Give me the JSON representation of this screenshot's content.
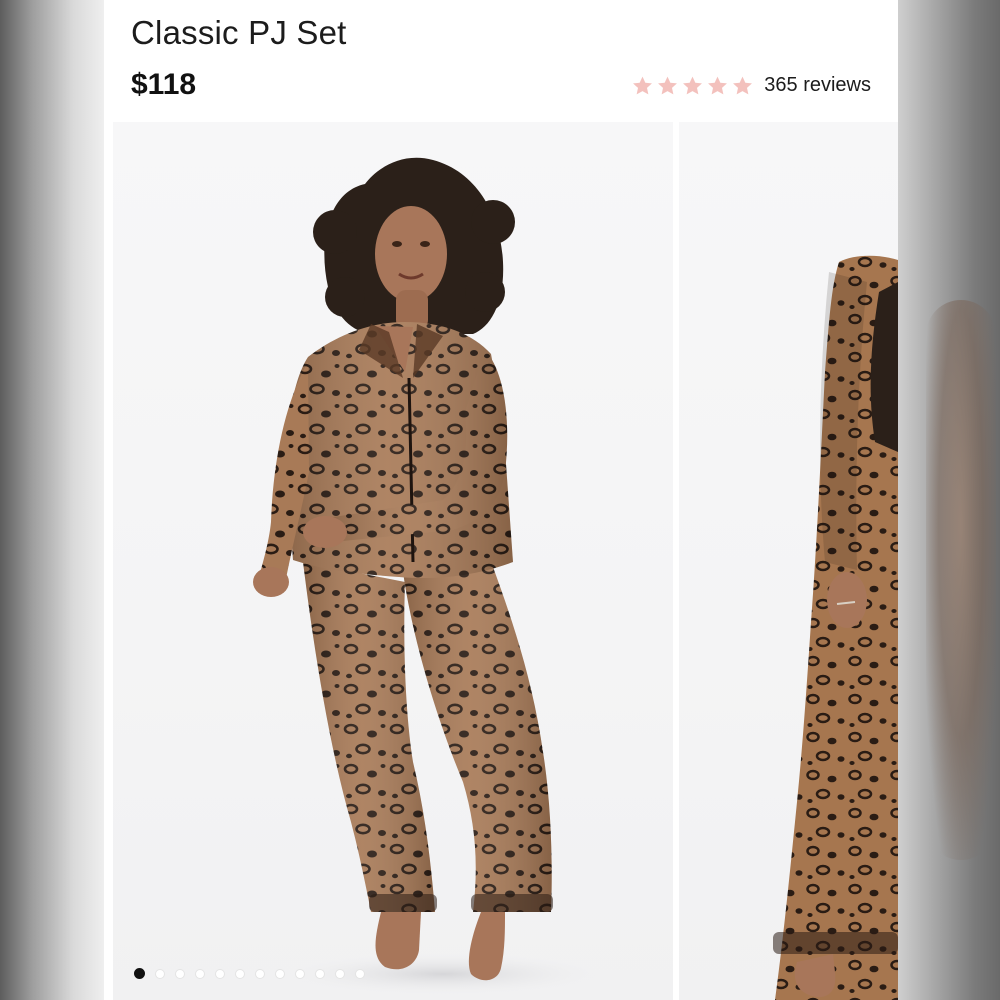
{
  "product": {
    "title": "Classic PJ Set",
    "price": "$118"
  },
  "rating": {
    "stars": 5,
    "star_color": "#f3c1bd",
    "review_count_label": "365 reviews"
  },
  "gallery": {
    "slide_count": 12,
    "active_index": 0,
    "slides": [
      {
        "name": "model-front-view"
      },
      {
        "name": "model-side-view"
      }
    ]
  },
  "colors": {
    "leopard_base": "#a87a57",
    "leopard_spot": "#2a1c14",
    "skin": "#a8765a",
    "hair": "#2b2019"
  }
}
